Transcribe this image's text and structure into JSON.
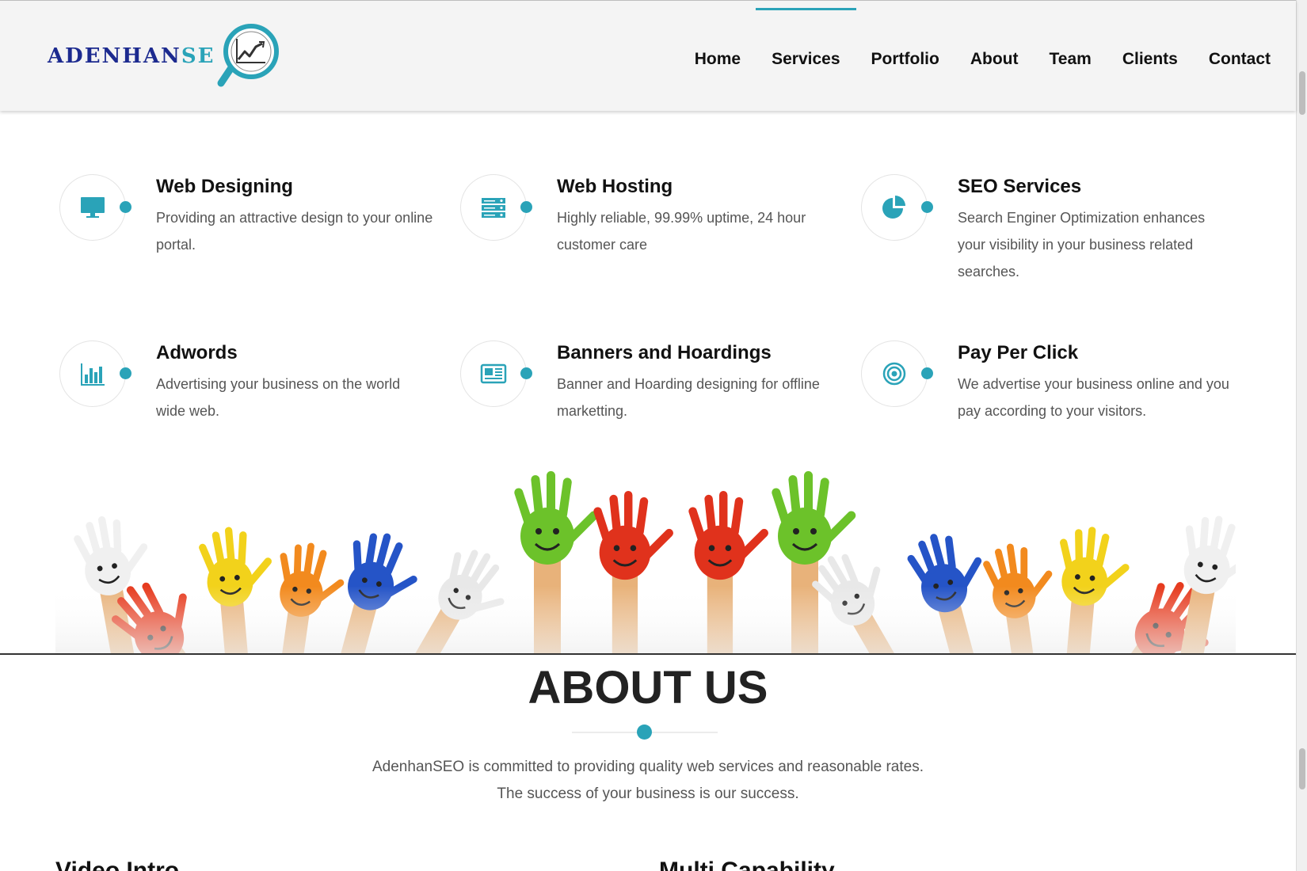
{
  "header": {
    "logo": {
      "text_main": "ADENHAN",
      "text_accent": "SE"
    },
    "nav": [
      "Home",
      "Services",
      "Portfolio",
      "About",
      "Team",
      "Clients",
      "Contact"
    ],
    "active_nav": "Services"
  },
  "colors": {
    "accent": "#2aa3b8",
    "logo_blue": "#1c2a8f"
  },
  "services": [
    {
      "title": "Web Designing",
      "desc": "Providing an attractive design to your online portal.",
      "icon": "monitor-icon"
    },
    {
      "title": "Web Hosting",
      "desc": "Highly reliable, 99.99% uptime, 24 hour customer care",
      "icon": "server-icon"
    },
    {
      "title": "SEO Services",
      "desc": "Search Enginer Optimization enhances your visibility in your business related searches.",
      "icon": "pie-chart-icon"
    },
    {
      "title": "Adwords",
      "desc": "Advertising your business on the world wide web.",
      "icon": "bar-chart-icon"
    },
    {
      "title": "Banners and Hoardings",
      "desc": "Banner and Hoarding designing for offline marketting.",
      "icon": "newspaper-icon"
    },
    {
      "title": "Pay Per Click",
      "desc": "We advertise your business online and you pay according to your visitors.",
      "icon": "target-icon"
    }
  ],
  "about": {
    "title": "ABOUT US",
    "line1": "AdenhanSEO is committed to providing quality web services and reasonable rates.",
    "line2": "The success of your business is our success."
  },
  "sections": {
    "left": "Video Intro",
    "right": "Multi Capability"
  }
}
